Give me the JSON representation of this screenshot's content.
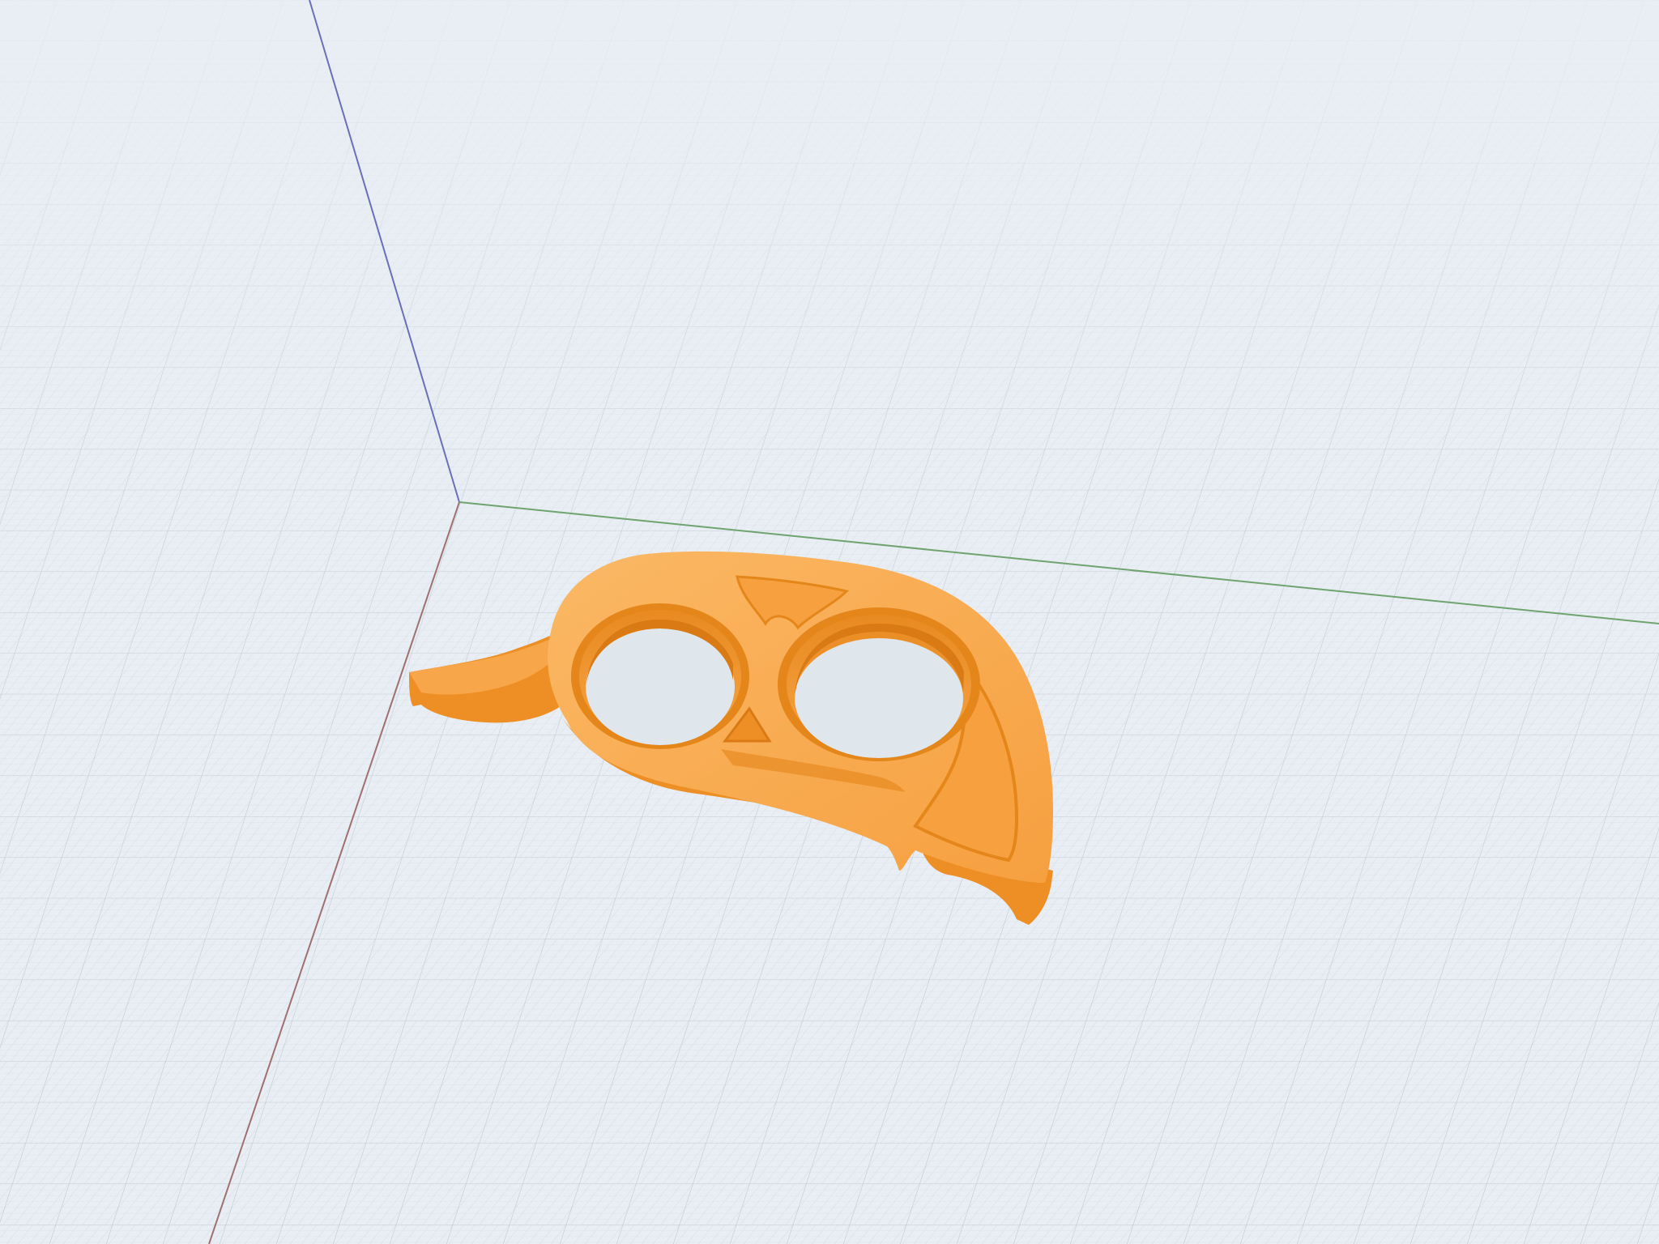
{
  "viewport": {
    "background_color": "#e8eef3",
    "grid_minor_color": "#cfd8e0",
    "grid_major_color": "#b9c4ce"
  },
  "axes": {
    "x_axis_color": "#a07070",
    "y_axis_color": "#6fa36f",
    "z_axis_color": "#6a70b8"
  },
  "model": {
    "description_icon": "keychain-tool-model",
    "top_color": "#f8a64a",
    "side_color": "#ee8f25",
    "shade_color": "#d97a14",
    "highlight_color": "#fbb865"
  }
}
